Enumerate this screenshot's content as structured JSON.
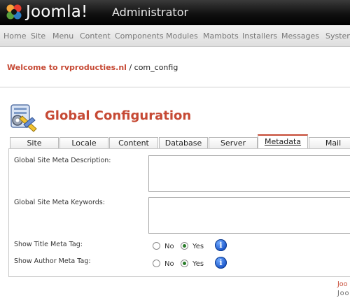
{
  "header": {
    "brand": "Joomla!",
    "subtitle": "Administrator"
  },
  "menu": [
    "Home",
    "Site",
    "Menu",
    "Content",
    "Components",
    "Modules",
    "Mambots",
    "Installers",
    "Messages",
    "System"
  ],
  "breadcrumb": {
    "welcome": "Welcome to rvproducties.nl",
    "path": " / com_config"
  },
  "page": {
    "title": "Global Configuration"
  },
  "tabs": [
    "Site",
    "Locale",
    "Content",
    "Database",
    "Server",
    "Metadata",
    "Mail"
  ],
  "form": {
    "meta_description_label": "Global Site Meta Description:",
    "meta_keywords_label": "Global Site Meta Keywords:",
    "title_tag_label": "Show Title Meta Tag:",
    "author_tag_label": "Show Author Meta Tag:",
    "no": "No",
    "yes": "Yes",
    "info_glyph": "i"
  },
  "footer": {
    "line1": "Joo",
    "line2": "Joo"
  },
  "colors": {
    "accent": "#c64934",
    "info": "#1b56c9"
  }
}
